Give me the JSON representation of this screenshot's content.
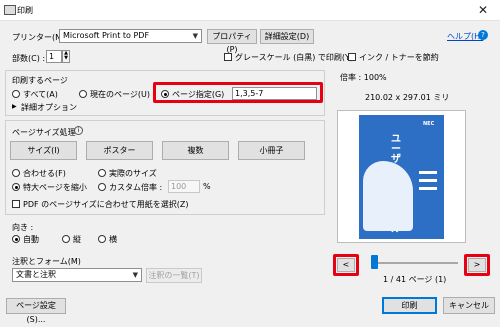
{
  "window": {
    "title": "印刷",
    "close_glyph": "✕"
  },
  "printer": {
    "label": "プリンター(N) :",
    "value": "Microsoft Print to PDF",
    "properties_button": "プロパティ(P)",
    "advanced_button": "詳細設定(D)",
    "help_link": "ヘルプ(H)"
  },
  "copies": {
    "label": "部数(C) :",
    "value": "1"
  },
  "options": {
    "grayscale": "グレースケール (白黒) で印刷(Y)",
    "save_ink": "インク / トナーを節約"
  },
  "pages": {
    "heading": "印刷するページ",
    "all": "すべて(A)",
    "current": "現在のページ(U)",
    "range": "ページ指定(G)",
    "range_value": "1,3,5-7",
    "more_options": "詳細オプション"
  },
  "sizing": {
    "heading": "ページサイズ処理",
    "info_glyph": "i",
    "buttons": [
      "サイズ(I)",
      "ポスター",
      "複数",
      "小冊子"
    ],
    "fit": "合わせる(F)",
    "actual": "実際のサイズ",
    "shrink": "特大ページを縮小",
    "custom": "カスタム倍率 :",
    "custom_value": "100",
    "percent": "%",
    "paper_by_pdf": "PDF のページサイズに合わせて用紙を選択(Z)"
  },
  "orientation": {
    "heading": "向き :",
    "auto": "自動",
    "portrait": "縦",
    "landscape": "横"
  },
  "comments": {
    "heading": "注釈とフォーム(M)",
    "value": "文書と注釈",
    "summary_button": "注釈の一覧(T)"
  },
  "preview": {
    "zoom": "倍率 : 100%",
    "dimensions": "210.02 x 297.01 ミリ",
    "prev": "<",
    "next": ">",
    "page_status": "1 / 41 ページ (1)",
    "doc_logo": "NEC",
    "doc_title": "ユーザーズマニュアル",
    "current_page_fraction": 0.024
  },
  "footer": {
    "page_setup": "ページ設定(S)...",
    "print": "印刷",
    "cancel": "キャンセル"
  },
  "colors": {
    "highlight": "#e60012",
    "accent": "#0078d7",
    "doc_blue": "#2c6fc4"
  }
}
